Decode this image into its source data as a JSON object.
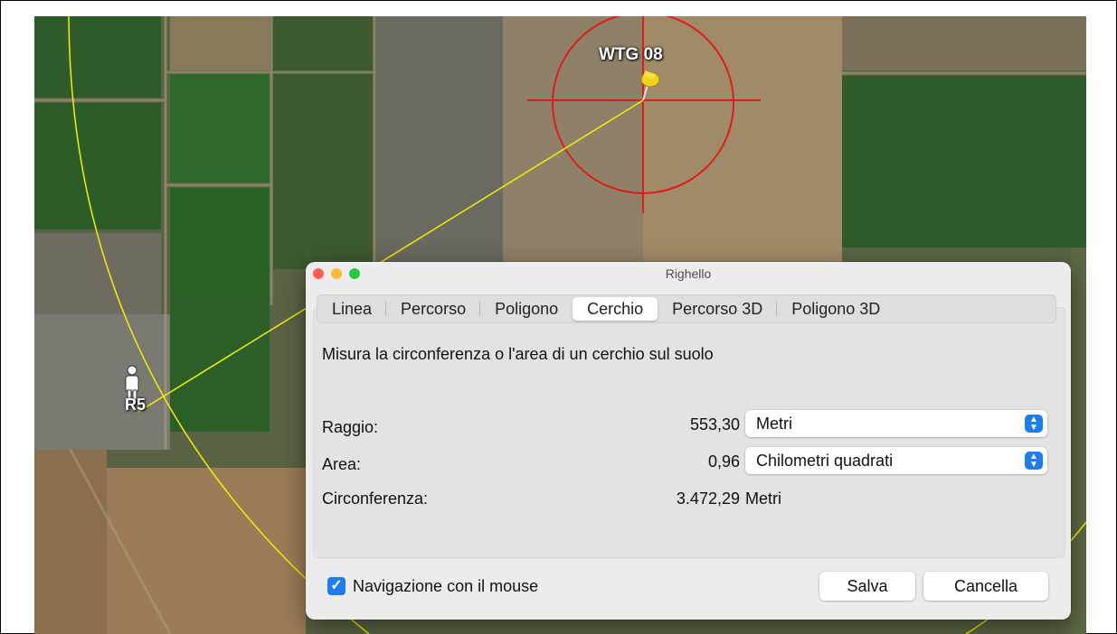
{
  "map": {
    "pin_label": "WTG 08",
    "person_label": "R5"
  },
  "window": {
    "title": "Righello",
    "tabs": [
      {
        "label": "Linea"
      },
      {
        "label": "Percorso"
      },
      {
        "label": "Poligono"
      },
      {
        "label": "Cerchio",
        "active": true
      },
      {
        "label": "Percorso 3D"
      },
      {
        "label": "Poligono 3D"
      }
    ],
    "description": "Misura la circonferenza o l'area di un cerchio sul suolo",
    "rows": {
      "radius": {
        "label": "Raggio:",
        "value": "553,30",
        "unit": "Metri"
      },
      "area": {
        "label": "Area:",
        "value": "0,96",
        "unit": "Chilometri quadrati"
      },
      "circumference": {
        "label": "Circonferenza:",
        "value": "3.472,29",
        "unit": "Metri"
      }
    },
    "mouse_nav": {
      "label": "Navigazione con il mouse",
      "checked": true
    },
    "save_label": "Salva",
    "cancel_label": "Cancella"
  },
  "colors": {
    "accent": "#1f7cf0",
    "measure_circle": "#e01b1b",
    "radius_line": "#f0f000"
  }
}
